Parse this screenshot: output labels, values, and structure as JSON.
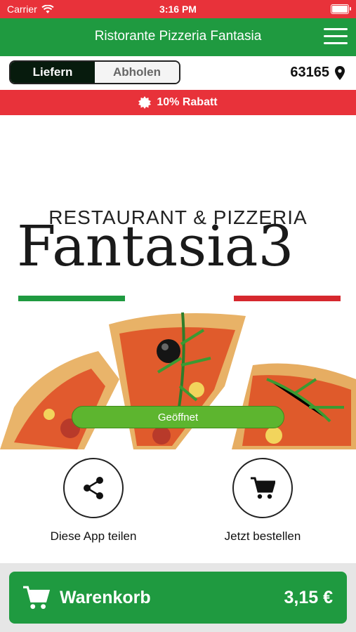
{
  "status_bar": {
    "carrier": "Carrier",
    "time": "3:16 PM"
  },
  "navbar": {
    "title": "Ristorante Pizzeria Fantasia"
  },
  "delivery_mode": {
    "options": [
      "Liefern",
      "Abholen"
    ],
    "selected": "Liefern"
  },
  "location": {
    "zip": "63165"
  },
  "promo": {
    "text": "10% Rabatt"
  },
  "hero": {
    "logo_subtitle": "RESTAURANT & PIZZERIA",
    "logo_title": "Fantasia3",
    "status_label": "Geöffnet"
  },
  "actions": {
    "share_label": "Diese App teilen",
    "order_label": "Jetzt bestellen"
  },
  "cart": {
    "label": "Warenkorb",
    "total": "3,15 €"
  },
  "colors": {
    "brand_green": "#1f9a40",
    "accent_red": "#e8323a",
    "open_green": "#5db52f"
  }
}
